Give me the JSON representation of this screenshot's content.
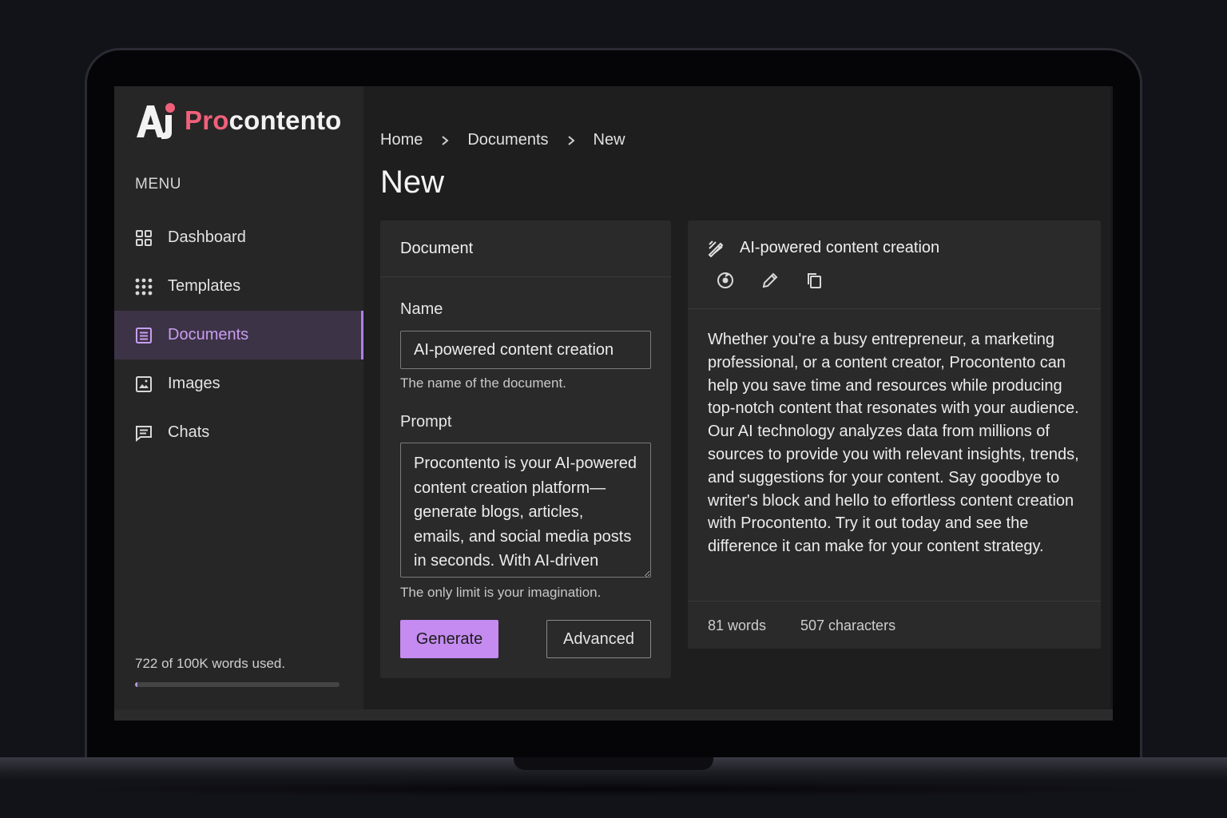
{
  "app": {
    "logo_prefix": "Pro",
    "logo_suffix": "contento",
    "logo_mark": "Ai",
    "accent_color": "#c58bf0",
    "logo_color": "#f0607a"
  },
  "sidebar": {
    "menu_label": "MENU",
    "items": [
      {
        "label": "Dashboard",
        "icon": "dashboard-grid-icon"
      },
      {
        "label": "Templates",
        "icon": "dots-grid-icon"
      },
      {
        "label": "Documents",
        "icon": "document-list-icon",
        "active": true
      },
      {
        "label": "Images",
        "icon": "image-icon"
      },
      {
        "label": "Chats",
        "icon": "chat-icon"
      }
    ],
    "usage_text": "722 of 100K words used.",
    "usage_fraction": 0.00722
  },
  "breadcrumb": [
    "Home",
    "Documents",
    "New"
  ],
  "page_title": "New",
  "document_form": {
    "title": "Document",
    "name_label": "Name",
    "name_value": "AI-powered content creation",
    "name_help": "The name of the document.",
    "prompt_label": "Prompt",
    "prompt_value": "Procontento is your AI-powered content creation platform—generate blogs, articles, emails, and social media posts in seconds. With AI-driven insights and ideas",
    "prompt_help": "The only limit is your imagination.",
    "generate_label": "Generate",
    "advanced_label": "Advanced"
  },
  "result": {
    "title": "AI-powered content creation",
    "body": "Whether you're a busy entrepreneur, a marketing professional, or a content creator, Procontento can help you save time and resources while producing top-notch content that resonates with your audience. Our AI technology analyzes data from millions of sources to provide you with relevant insights, trends, and suggestions for your content. Say goodbye to writer's block and hello to effortless content creation with Procontento. Try it out today and see the difference it can make for your content strategy.",
    "words": "81 words",
    "characters": "507 characters"
  }
}
